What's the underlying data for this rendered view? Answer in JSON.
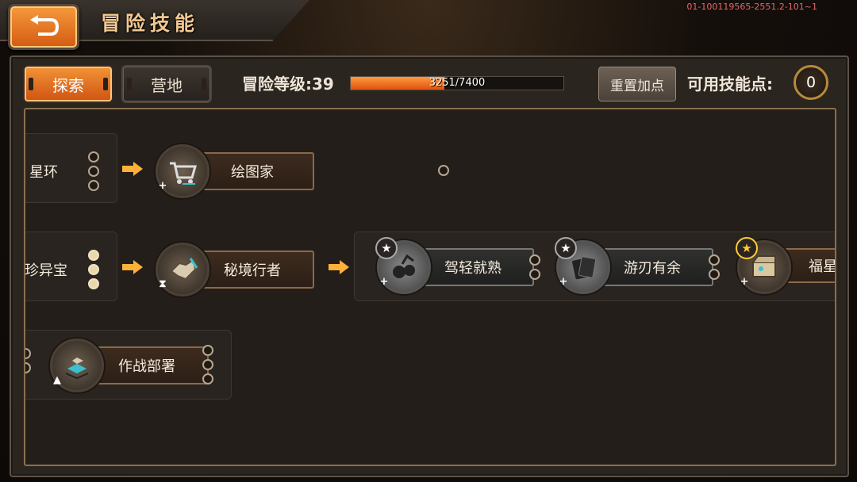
{
  "header": {
    "title": "冒险技能",
    "version": "01-100119565-2551.2-101~1"
  },
  "tabs": [
    {
      "label": "探索",
      "active": true
    },
    {
      "label": "营地",
      "active": false
    }
  ],
  "level": {
    "label": "冒险等级:39",
    "current": 3251,
    "max": 7400,
    "text": "3251/7400"
  },
  "reset_label": "重置加点",
  "points": {
    "label": "可用技能点:",
    "value": "0"
  },
  "skills": {
    "row1_partial": "星环",
    "row1_node": "绘图家",
    "row2_partial": "珍异宝",
    "row2_node": "秘境行者",
    "row2_group": [
      "驾轻就熟",
      "游刃有余",
      "福星"
    ],
    "row3_node": "作战部署"
  },
  "colors": {
    "accent": "#e0661a",
    "gold": "#b88a3a",
    "version_text": "#e36a6a"
  }
}
